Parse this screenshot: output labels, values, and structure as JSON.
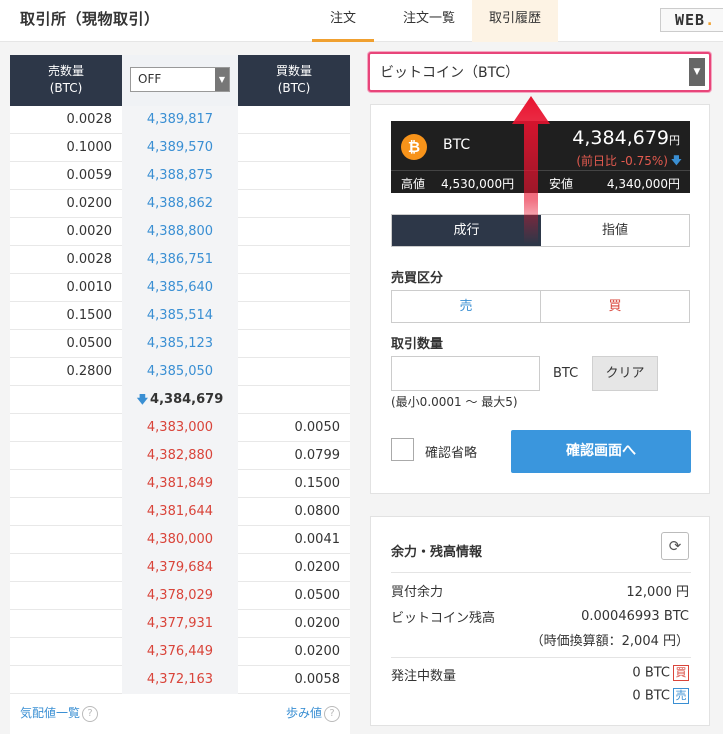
{
  "header": {
    "title": "取引所（現物取引）",
    "tabs": [
      "注文",
      "注文一覧",
      "取引履歴"
    ],
    "logo_text": "WEB",
    "logo_suffix": "."
  },
  "book": {
    "sell_header": [
      "売数量",
      "(BTC)"
    ],
    "buy_header": [
      "買数量",
      "(BTC)"
    ],
    "grouping_select": "OFF",
    "asks": [
      {
        "qty": "0.0028",
        "price": "4,389,817"
      },
      {
        "qty": "0.1000",
        "price": "4,389,570"
      },
      {
        "qty": "0.0059",
        "price": "4,388,875"
      },
      {
        "qty": "0.0200",
        "price": "4,388,862"
      },
      {
        "qty": "0.0020",
        "price": "4,388,800"
      },
      {
        "qty": "0.0028",
        "price": "4,386,751"
      },
      {
        "qty": "0.0010",
        "price": "4,385,640"
      },
      {
        "qty": "0.1500",
        "price": "4,385,514"
      },
      {
        "qty": "0.0500",
        "price": "4,385,123"
      },
      {
        "qty": "0.2800",
        "price": "4,385,050"
      }
    ],
    "last_price": "4,384,679",
    "last_arrow": "down",
    "bids": [
      {
        "price": "4,383,000",
        "qty": "0.0050"
      },
      {
        "price": "4,382,880",
        "qty": "0.0799"
      },
      {
        "price": "4,381,849",
        "qty": "0.1500"
      },
      {
        "price": "4,381,644",
        "qty": "0.0800"
      },
      {
        "price": "4,380,000",
        "qty": "0.0041"
      },
      {
        "price": "4,379,684",
        "qty": "0.0200"
      },
      {
        "price": "4,378,029",
        "qty": "0.0500"
      },
      {
        "price": "4,377,931",
        "qty": "0.0200"
      },
      {
        "price": "4,376,449",
        "qty": "0.0200"
      },
      {
        "price": "4,372,163",
        "qty": "0.0058"
      }
    ],
    "footer_left": "気配値一覧",
    "footer_right": "歩み値",
    "help": "?"
  },
  "order": {
    "coin_select": "ビットコイン（BTC）",
    "ticker": {
      "symbol": "BTC",
      "price": "4,384,679",
      "price_unit": "円",
      "change": "(前日比 -0.75%)",
      "high_label": "高値",
      "high_value": "4,530,000円",
      "low_label": "安値",
      "low_value": "4,340,000円"
    },
    "order_types": [
      "成行",
      "指値"
    ],
    "side_label": "売買区分",
    "sides": [
      "売",
      "買"
    ],
    "qty_label": "取引数量",
    "qty_value": "",
    "qty_unit": "BTC",
    "clear_label": "クリア",
    "qty_range": "(最小0.0001 〜 最大5)",
    "skip_confirm_label": "確認省略",
    "confirm_button": "確認画面へ"
  },
  "balance": {
    "title": "余力・残高情報",
    "buying_power_label": "買付余力",
    "buying_power_value": "12,000 円",
    "btc_balance_label": "ビットコイン残高",
    "btc_balance_value": "0.00046993 BTC",
    "btc_balance_jpy": "（時価換算額：2,004 円）",
    "pending_label": "発注中数量",
    "pending_buy": "0 BTC",
    "pending_buy_badge": "買",
    "pending_sell": "0 BTC",
    "pending_sell_badge": "売"
  },
  "colors": {
    "accent_highlight": "#e8457a",
    "annotation_arrow": "#e8132f",
    "ask_price": "#3a8fd3",
    "bid_price": "#d9443a",
    "primary_button": "#3a96dd",
    "header_dark": "#2d3748"
  }
}
